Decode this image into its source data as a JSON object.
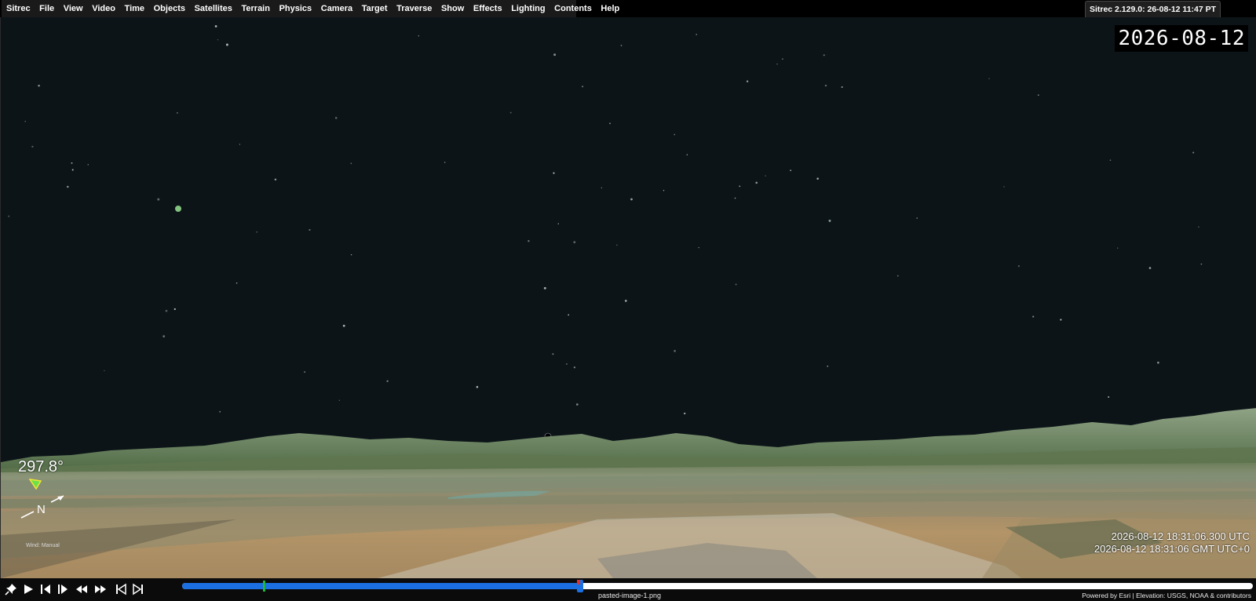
{
  "menu": {
    "items": [
      "Sitrec",
      "File",
      "View",
      "Video",
      "Time",
      "Objects",
      "Satellites",
      "Terrain",
      "Physics",
      "Camera",
      "Target",
      "Traverse",
      "Show",
      "Effects",
      "Lighting",
      "Contents",
      "Help"
    ]
  },
  "version_label": "Sitrec 2.129.0: 26-08-12 11:47 PT",
  "view": {
    "date_overlay": "2026-08-12",
    "heading": "297.8°",
    "compass_label": "N",
    "wind_label": "Wind: Manual",
    "time_utc": "2026-08-12 18:31:06.300 UTC",
    "time_gmt": "2026-08-12 18:31:06 GMT UTC+0"
  },
  "playback": {
    "position": 0.372,
    "filename": "pasted-image-1.png",
    "credits": "Powered by Esri | Elevation: USGS, NOAA & contributors"
  },
  "icons": {
    "pin": "pin-icon",
    "play": "play-icon",
    "step_back": "step-back-icon",
    "step_forward": "step-forward-icon",
    "rewind": "rewind-icon",
    "fast_forward": "fast-forward-icon",
    "skip_start": "skip-start-icon",
    "skip_end": "skip-end-icon"
  },
  "colors": {
    "sky": "#0c1418",
    "timeline_fill": "#1c6fe0",
    "timeline_track": "#ffffff",
    "timeline_start_marker": "#1db83b",
    "timeline_handle": "#e0322b"
  }
}
